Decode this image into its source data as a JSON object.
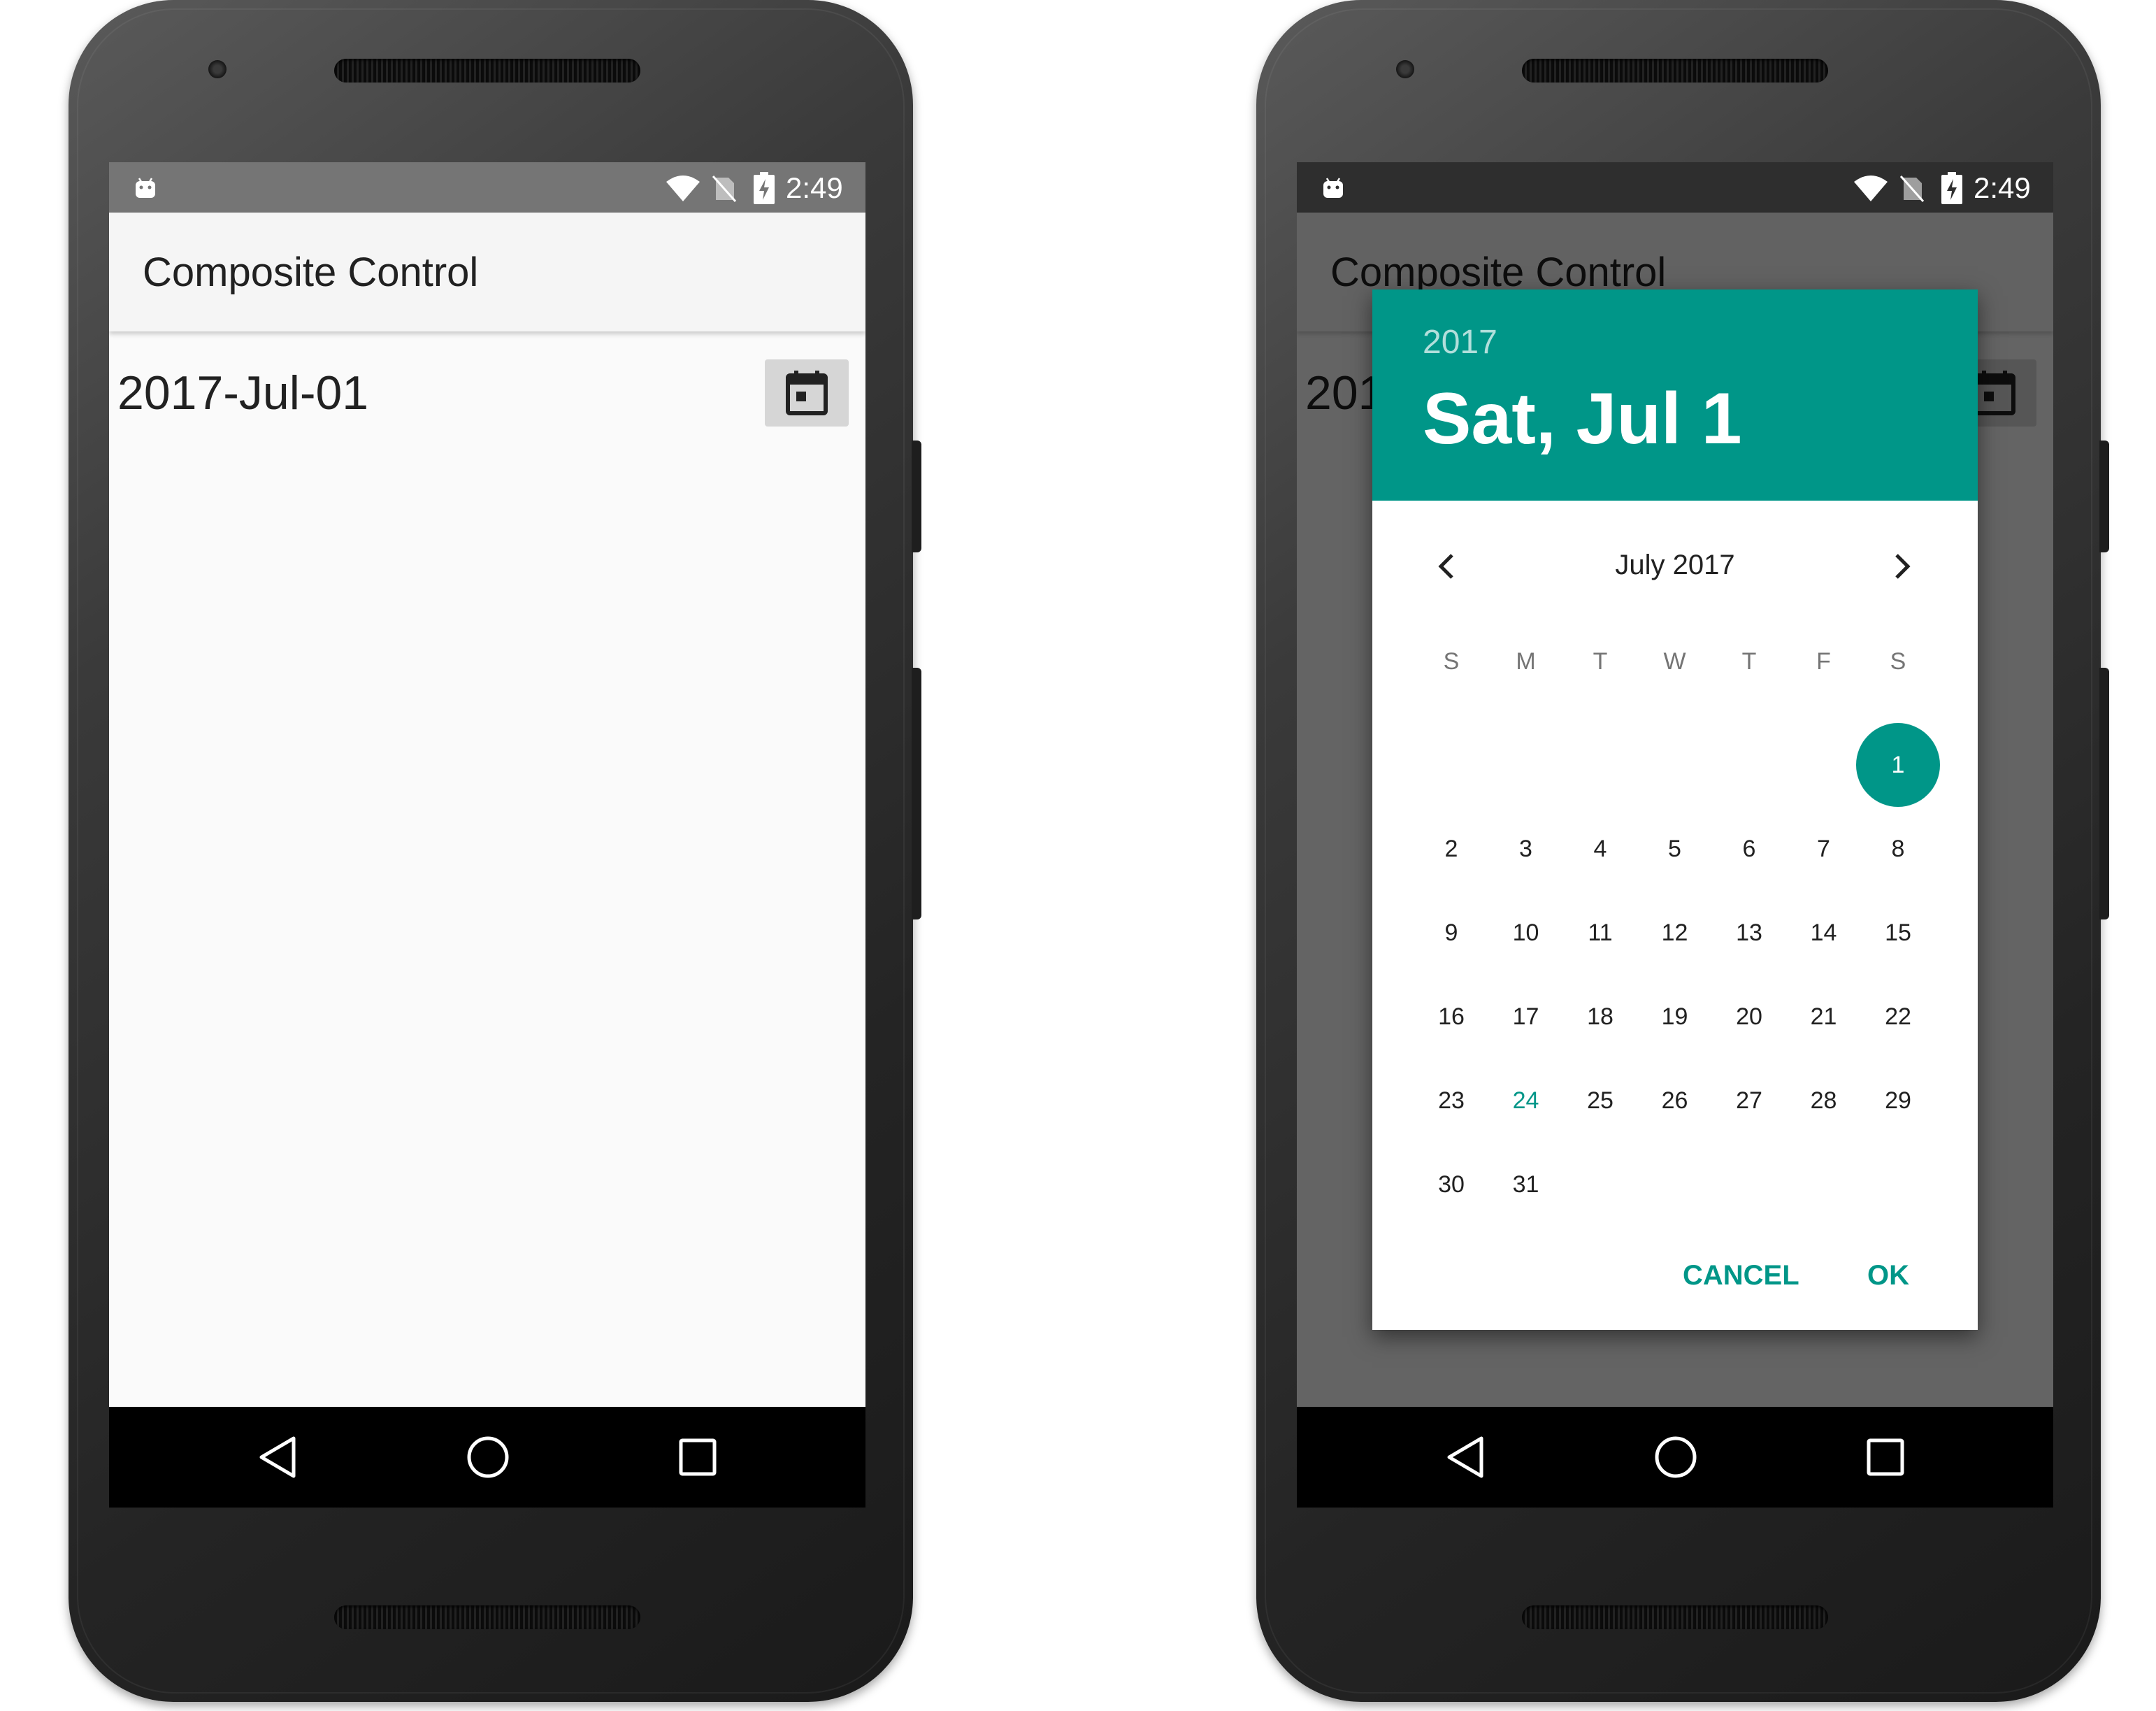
{
  "status_bar": {
    "time": "2:49"
  },
  "app": {
    "title": "Composite Control"
  },
  "control": {
    "date_text": "2017-Jul-01"
  },
  "background_date_partial": "201",
  "date_picker": {
    "year": "2017",
    "selected_date": "Sat, Jul 1",
    "month_label": "July 2017",
    "weekdays": [
      "S",
      "M",
      "T",
      "W",
      "T",
      "F",
      "S"
    ],
    "days": [
      "1",
      "2",
      "3",
      "4",
      "5",
      "6",
      "7",
      "8",
      "9",
      "10",
      "11",
      "12",
      "13",
      "14",
      "15",
      "16",
      "17",
      "18",
      "19",
      "20",
      "21",
      "22",
      "23",
      "24",
      "25",
      "26",
      "27",
      "28",
      "29",
      "30",
      "31"
    ],
    "first_weekday_index": 6,
    "selected_day": "1",
    "today_day": "24",
    "cancel_label": "CANCEL",
    "ok_label": "OK"
  },
  "colors": {
    "accent": "#009688",
    "accent_light": "#b2dfdb",
    "appbar": "#f5f5f5",
    "text": "#212121"
  },
  "icons": [
    "android-icon",
    "wifi-icon",
    "no-sim-icon",
    "battery-charging-icon",
    "calendar-icon",
    "chevron-left-icon",
    "chevron-right-icon",
    "back-icon",
    "home-icon",
    "recents-icon"
  ]
}
